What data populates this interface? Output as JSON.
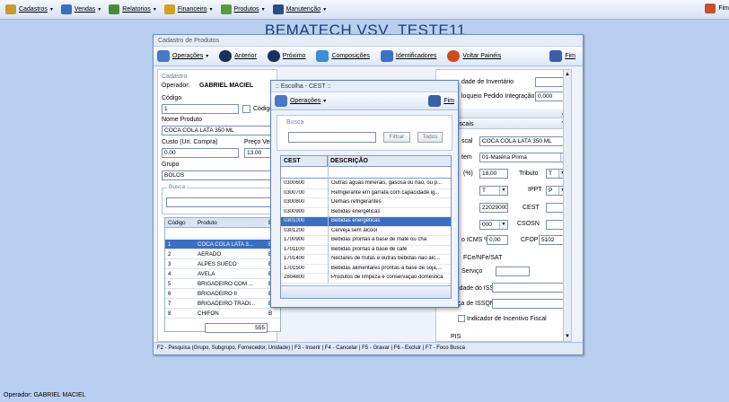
{
  "menu": {
    "items": [
      {
        "label": "Cadastros",
        "color": "#c89a2c"
      },
      {
        "label": "Vendas",
        "color": "#3a6fc4"
      },
      {
        "label": "Relatorios",
        "color": "#4a8a3a"
      },
      {
        "label": "Financeiro",
        "color": "#d4a020"
      },
      {
        "label": "Produtos",
        "color": "#5a9a3a"
      },
      {
        "label": "Manutenção",
        "color": "#2a4a8a"
      }
    ],
    "exit_label": "Fim"
  },
  "background_title": "BEMATECH VSV_TESTE11",
  "product_window": {
    "title": "Cadastro de Produtos",
    "toolbar": {
      "operacoes": "Operações",
      "anterior": "Anterior",
      "proximo": "Próximo",
      "composicoes": "Composições",
      "identificadores": "Identificadores",
      "voltar_paineis": "Voltar Painéis",
      "fim": "Fim"
    },
    "cadastro": {
      "group_label": "Cadastro",
      "operator_label": "Operador:",
      "operator_value": "GABRIEL MACIEL",
      "codigo_label": "Código",
      "codigo_value": "1",
      "codigo_check_label": "Código d",
      "nome_label": "Nome Produto",
      "nome_value": "COCA COLA LATA 350 ML",
      "custo_label": "Custo (Un. Compra)",
      "custo_value": "0.00",
      "preco_label": "Preço Ven",
      "preco_value": "13.00",
      "grupo_label": "Grupo",
      "grupo_value": "BOLOS",
      "busca_label": "Busca"
    },
    "grid": {
      "headers": [
        "Código",
        "Produto",
        "B"
      ],
      "rows": [
        {
          "code": "1",
          "name": "COCA COLA LATA 3...",
          "b": "B"
        },
        {
          "code": "2",
          "name": "AERADO",
          "b": "B"
        },
        {
          "code": "3",
          "name": "ALPES SUECO",
          "b": "B"
        },
        {
          "code": "4",
          "name": "AVELA",
          "b": "B"
        },
        {
          "code": "5",
          "name": "BRIGADEIRO COM ...",
          "b": "B"
        },
        {
          "code": "6",
          "name": "BRIGADEIRO II",
          "b": "B"
        },
        {
          "code": "7",
          "name": "BRIGADEIRO TRADI...",
          "b": "B"
        },
        {
          "code": "8",
          "name": "CHIFON",
          "b": "B"
        }
      ],
      "total": "555"
    },
    "right_panel": {
      "unidade_inventario": "dade de Inventário",
      "bloqueio_label": "loqueio Pedido Integração",
      "bloqueio_value": "0,000",
      "fiscais_label": "iscais",
      "ncm_label": "scal",
      "ncm_value": "COCA COLA LATA 350 ML",
      "item_label": "tem",
      "item_value": "01-Matéria Prima",
      "pct_label": "(%)",
      "pct_value": "18,00",
      "tributo_label": "Tributo",
      "tributo_value": "T",
      "t_value": "T",
      "ippt_label": "IPPT",
      "ippt_value": "P",
      "cest_value": "22029000",
      "cest_label": "CEST",
      "csosn_num": "000",
      "csosn_label": "CSOSN",
      "icms_label": "o ICMS % ",
      "icms_value": "0,00",
      "cfop_label": "CFOP",
      "cfop_value": "5102",
      "nfe_label": "FCe/NFe/SAT",
      "servico_label": "Serviço",
      "iss_label": "idade do ISS",
      "issqn_label": "ça de ISSQN",
      "incentivo_label": "Indicador de Incentivo Fiscal",
      "pis_label": "PIS"
    },
    "footer": "F2 - Pesquisa (Grupo, Subgrupo, Fornecedor, Unidade)  |  F3 - Inserir  |  F4 - Cancelar  |  F5 - Gravar  |  F6 - Excluir  |  F7 - Foco Busca"
  },
  "cest_dialog": {
    "title": ":: Escolha - CEST ::",
    "operacoes": "Operações",
    "fim": "Fim",
    "busca_label": "Busca",
    "filtrar": "Filtrar",
    "todos": "Todos",
    "col_cest": "CEST",
    "col_descricao": "DESCRIÇÃO",
    "selected_index": 4,
    "rows": [
      {
        "cest": "0300600",
        "desc": "Outras águas minerais, gasosa ou não, ou p..."
      },
      {
        "cest": "0300700",
        "desc": "Refrigerante em garrafa com capacidade ig..."
      },
      {
        "cest": "0300800",
        "desc": "Demais refrigerantes"
      },
      {
        "cest": "0300900",
        "desc": "Bebidas energéticas"
      },
      {
        "cest": "0301000",
        "desc": "Bebidas energéticas"
      },
      {
        "cest": "0301200",
        "desc": "Cerveja sem álcool"
      },
      {
        "cest": "1700900",
        "desc": "Bebidas prontas à base de mate ou chá"
      },
      {
        "cest": "1701100",
        "desc": "Bebidas prontas à base de café"
      },
      {
        "cest": "1701400",
        "desc": "Néctares de frutas e outras bebidas não álc..."
      },
      {
        "cest": "1701500",
        "desc": "Bebidas alimentares prontas à base de soja,..."
      },
      {
        "cest": "2804800",
        "desc": "Produtos de limpeza e conservação doméstica"
      }
    ]
  },
  "status": "Operador: GABRIEL MACIEL"
}
